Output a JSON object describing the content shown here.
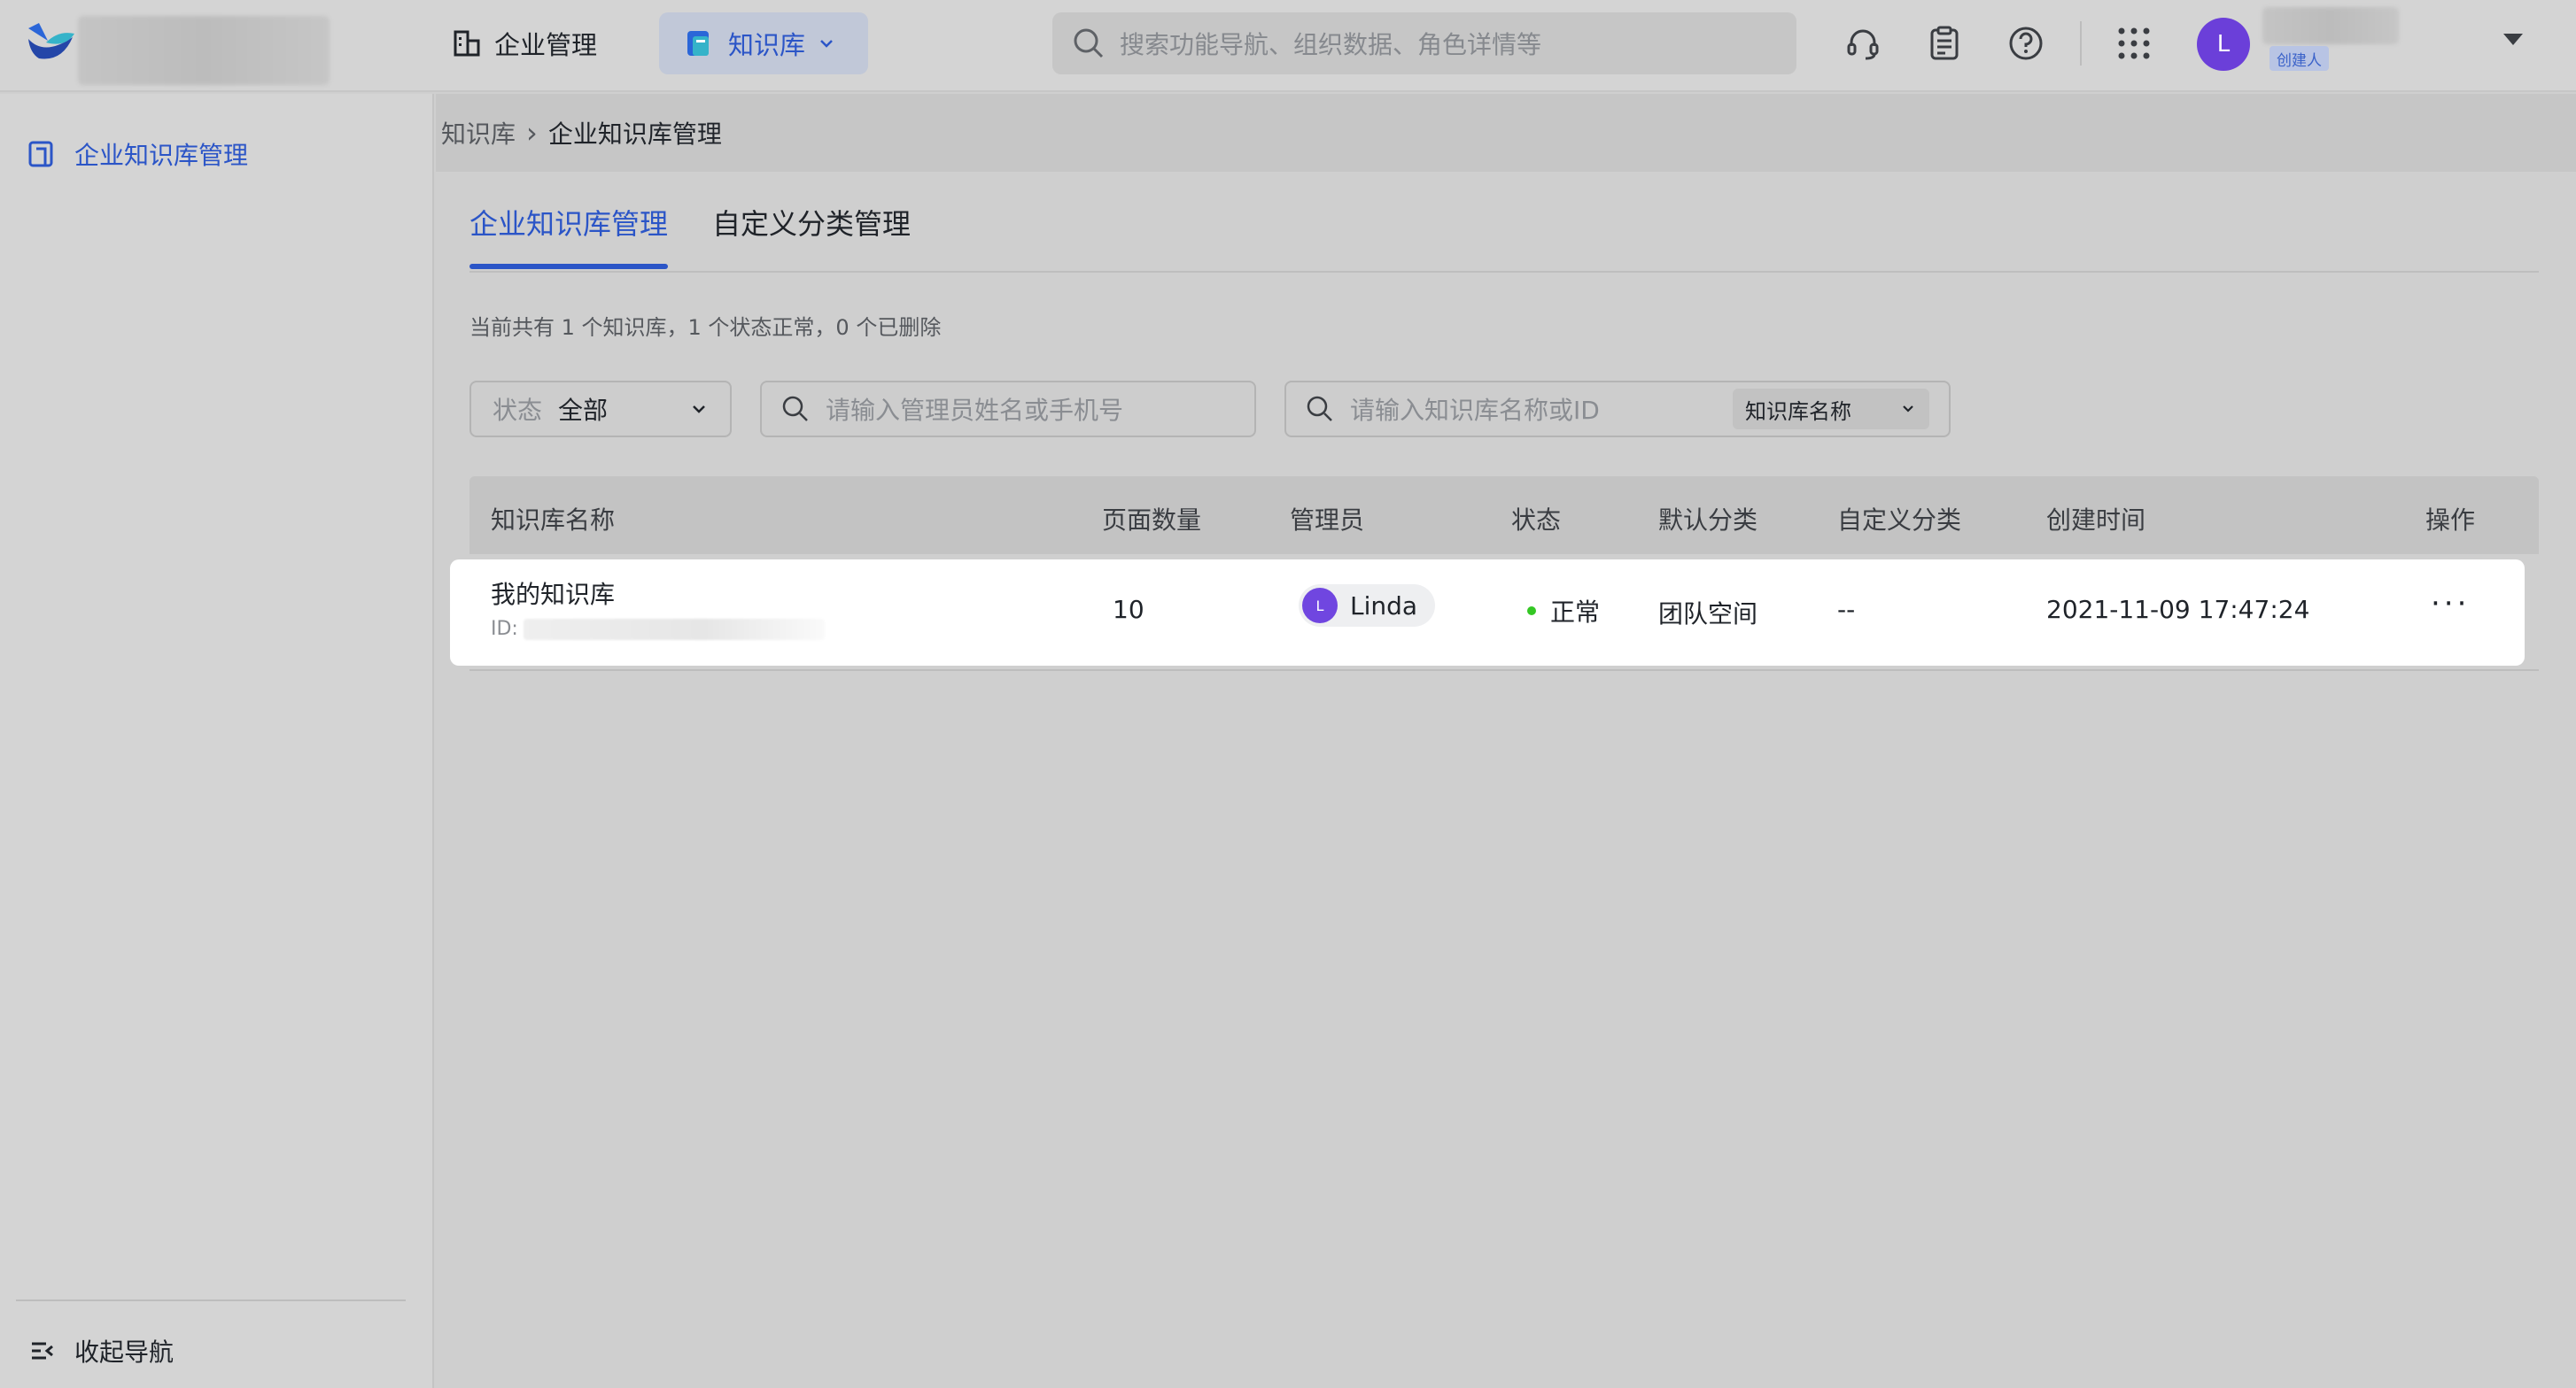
{
  "header": {
    "nav_enterprise": "企业管理",
    "nav_kb": "知识库",
    "search_placeholder": "搜索功能导航、组织数据、角色详情等",
    "user_initial": "L",
    "user_role_badge": "创建人"
  },
  "sidebar": {
    "item_label": "企业知识库管理",
    "collapse_label": "收起导航"
  },
  "breadcrumb": {
    "root": "知识库",
    "separator": "›",
    "current": "企业知识库管理"
  },
  "tabs": [
    {
      "label": "企业知识库管理",
      "active": true
    },
    {
      "label": "自定义分类管理",
      "active": false
    }
  ],
  "summary": "当前共有 1 个知识库，1 个状态正常，0 个已删除",
  "filters": {
    "status_label": "状态",
    "status_value": "全部",
    "admin_placeholder": "请输入管理员姓名或手机号",
    "kb_placeholder": "请输入知识库名称或ID",
    "kb_select_value": "知识库名称"
  },
  "table": {
    "columns": [
      "知识库名称",
      "页面数量",
      "管理员",
      "状态",
      "默认分类",
      "自定义分类",
      "创建时间",
      "操作"
    ],
    "rows": [
      {
        "name": "我的知识库",
        "id_label": "ID:",
        "pages": "10",
        "admin_initial": "L",
        "admin_name": "Linda",
        "status": "正常",
        "default_category": "团队空间",
        "custom_category": "--",
        "created_at": "2021-11-09 17:47:24",
        "action": "···"
      }
    ]
  },
  "colors": {
    "accent": "#2b55c7",
    "avatar": "#6b3fd9",
    "status_ok": "#34c724"
  }
}
